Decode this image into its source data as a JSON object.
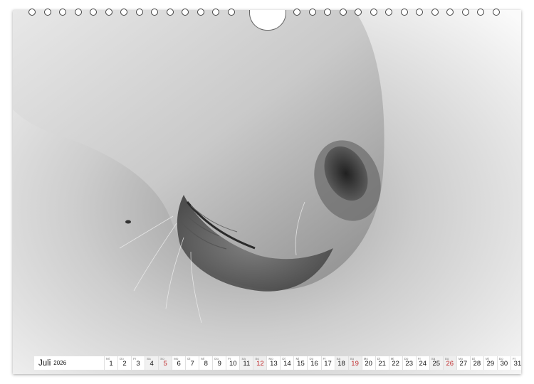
{
  "calendar": {
    "month": "Juli",
    "year": "2026",
    "days": [
      {
        "n": "1",
        "wd": "Mi"
      },
      {
        "n": "2",
        "wd": "Do"
      },
      {
        "n": "3",
        "wd": "Fr"
      },
      {
        "n": "4",
        "wd": "Sa"
      },
      {
        "n": "5",
        "wd": "So"
      },
      {
        "n": "6",
        "wd": "Mo"
      },
      {
        "n": "7",
        "wd": "Di"
      },
      {
        "n": "8",
        "wd": "Mi"
      },
      {
        "n": "9",
        "wd": "Do"
      },
      {
        "n": "10",
        "wd": "Fr"
      },
      {
        "n": "11",
        "wd": "Sa"
      },
      {
        "n": "12",
        "wd": "So"
      },
      {
        "n": "13",
        "wd": "Mo"
      },
      {
        "n": "14",
        "wd": "Di"
      },
      {
        "n": "15",
        "wd": "Mi"
      },
      {
        "n": "16",
        "wd": "Do"
      },
      {
        "n": "17",
        "wd": "Fr"
      },
      {
        "n": "18",
        "wd": "Sa"
      },
      {
        "n": "19",
        "wd": "So"
      },
      {
        "n": "20",
        "wd": "Mo"
      },
      {
        "n": "21",
        "wd": "Di"
      },
      {
        "n": "22",
        "wd": "Mi"
      },
      {
        "n": "23",
        "wd": "Do"
      },
      {
        "n": "24",
        "wd": "Fr"
      },
      {
        "n": "25",
        "wd": "Sa"
      },
      {
        "n": "26",
        "wd": "So"
      },
      {
        "n": "27",
        "wd": "Mo"
      },
      {
        "n": "28",
        "wd": "Di"
      },
      {
        "n": "29",
        "wd": "Mi"
      },
      {
        "n": "30",
        "wd": "Do"
      },
      {
        "n": "31",
        "wd": "Fr"
      }
    ]
  },
  "colors": {
    "sunday": "#c0282a",
    "background": "#f4f4f4"
  }
}
